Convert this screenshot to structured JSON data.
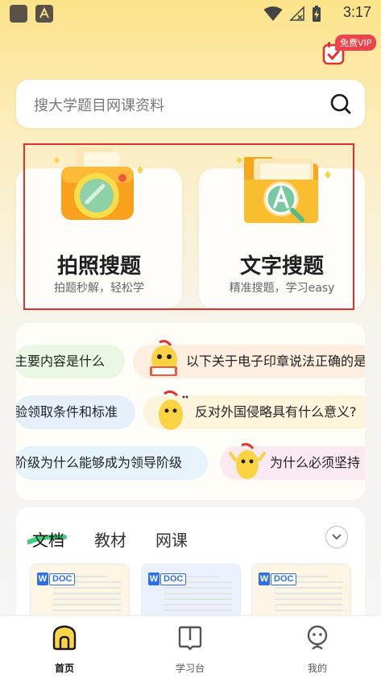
{
  "status_bar": {
    "time": "3:17"
  },
  "header": {
    "vip_badge": "免费VIP",
    "vip_icon": "calendar-check-icon"
  },
  "search": {
    "placeholder": "搜大学题目网课资料",
    "icon": "search-icon"
  },
  "cards": [
    {
      "title": "拍照搜题",
      "subtitle": "拍题秒解，轻松学",
      "icon": "camera-icon"
    },
    {
      "title": "文字搜题",
      "subtitle": "精准搜题，学习easy",
      "icon": "folder-search-icon"
    }
  ],
  "questions": [
    {
      "text": "主要内容是什么",
      "color": "#eaf7e4"
    },
    {
      "text": "以下关于电子印章说法正确的是",
      "color": "#fdeee0"
    },
    {
      "text": "验领取条件和标准",
      "color": "#e6f0fb"
    },
    {
      "text": "反对外国侵略具有什么意义?",
      "color": "#fdf4dc"
    },
    {
      "text": "阶级为什么能够成为领导阶级",
      "color": "#e6f3fb"
    },
    {
      "text": "为什么必须坚持",
      "color": "#fbe9f1"
    }
  ],
  "docs": {
    "tabs": [
      "文档",
      "教材",
      "网课"
    ],
    "active_tab": 0,
    "items": [
      {
        "w": "W",
        "type": "DOC"
      },
      {
        "w": "W",
        "type": "DOC"
      },
      {
        "w": "W",
        "type": "DOC"
      }
    ]
  },
  "nav": [
    {
      "label": "首页",
      "icon": "home-icon"
    },
    {
      "label": "学习台",
      "icon": "book-icon"
    },
    {
      "label": "我的",
      "icon": "profile-icon"
    }
  ],
  "colors": {
    "accent_yellow": "#fbd447",
    "highlight_red": "#e0312b",
    "vip_red": "#f0424c",
    "doc_blue": "#2f6fe8"
  }
}
